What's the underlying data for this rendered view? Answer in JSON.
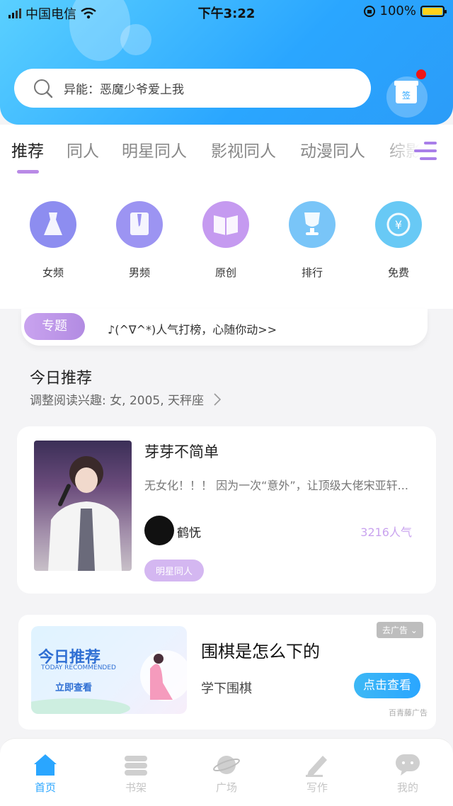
{
  "status_bar": {
    "carrier": "中国电信",
    "time": "下午3:22",
    "battery": "100%"
  },
  "search": {
    "placeholder": "异能：恶魔少爷爱上我"
  },
  "gift": {
    "label": "签"
  },
  "tabs": [
    {
      "label": "推荐",
      "active": true
    },
    {
      "label": "同人"
    },
    {
      "label": "明星同人"
    },
    {
      "label": "影视同人"
    },
    {
      "label": "动漫同人"
    },
    {
      "label": "综影"
    }
  ],
  "categories": [
    {
      "label": "女频",
      "icon": "dress-icon",
      "color": "#8d8df0"
    },
    {
      "label": "男频",
      "icon": "shirt-icon",
      "color": "#9c94f2"
    },
    {
      "label": "原创",
      "icon": "book-icon",
      "color": "#c59af0"
    },
    {
      "label": "排行",
      "icon": "trophy-icon",
      "color": "#79c5f8"
    },
    {
      "label": "免费",
      "icon": "yuan-icon",
      "color": "#68c9f5"
    }
  ],
  "topic": {
    "badge": "专题",
    "text": "♪(^∇^*)人气打榜，心随你动>>"
  },
  "recommend": {
    "title": "今日推荐",
    "subtitle": "调整阅读兴趣: 女, 2005, 天秤座"
  },
  "book": {
    "title": "芽芽不简单",
    "description": "无女化！！！ 因为一次“意外”，让顶级大佬宋亚轩...",
    "author": "鹤怃",
    "popularity": "3216人气",
    "tag": "明星同人"
  },
  "ad": {
    "image_title": "今日推荐",
    "image_subtitle": "TODAY RECOMMENDED",
    "image_action": "立即查看",
    "title": "围棋是怎么下的",
    "subtitle": "学下围棋",
    "button": "点击查看",
    "close": "去广告",
    "source": "百青藤广告"
  },
  "tabbar": [
    {
      "label": "首页",
      "icon": "home-icon",
      "active": true
    },
    {
      "label": "书架",
      "icon": "bookshelf-icon"
    },
    {
      "label": "广场",
      "icon": "planet-icon"
    },
    {
      "label": "写作",
      "icon": "pen-icon"
    },
    {
      "label": "我的",
      "icon": "chat-bubble-icon"
    }
  ],
  "colors": {
    "accent": "#2aa6ff",
    "purple": "#b98ae6"
  }
}
